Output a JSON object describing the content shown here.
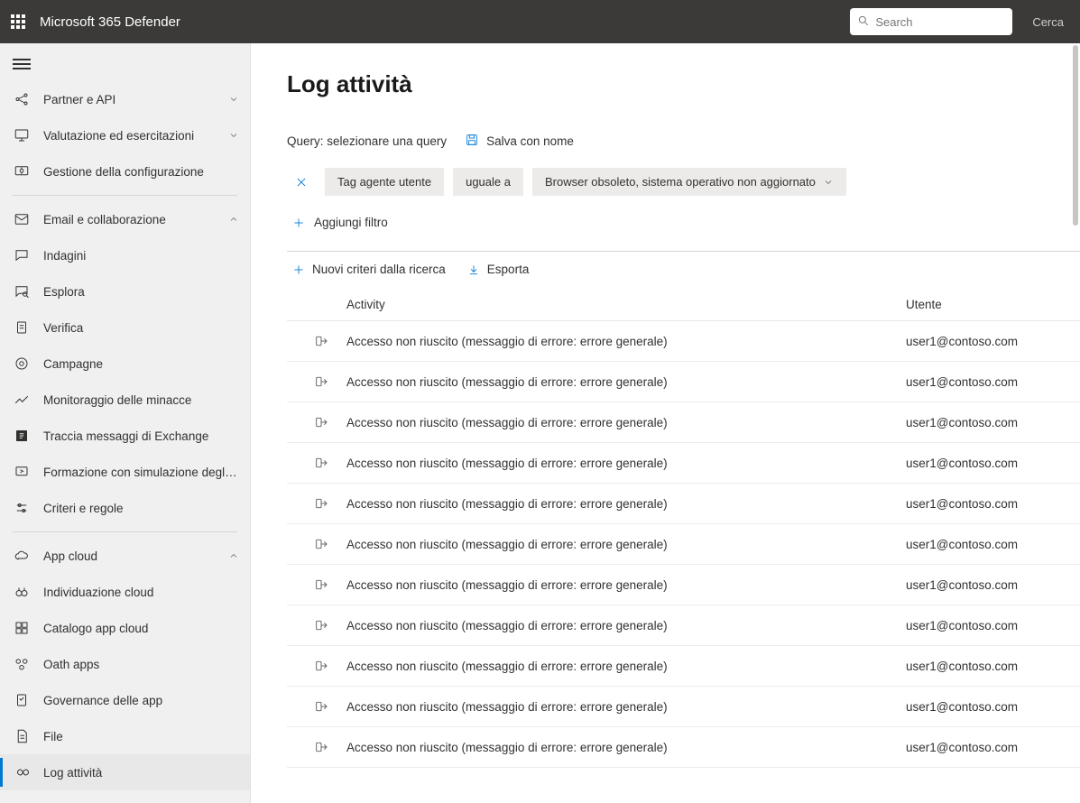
{
  "header": {
    "app_title": "Microsoft 365 Defender",
    "search_placeholder": "Search",
    "search_side_text": "Cerca"
  },
  "sidebar": {
    "groups": [
      {
        "items": [
          {
            "icon": "share-nodes",
            "label": "Partner e API",
            "chevron": "down"
          },
          {
            "icon": "monitor",
            "label": "Valutazione ed esercitazioni",
            "chevron": "down"
          },
          {
            "icon": "gear-monitor",
            "label": "Gestione della configurazione"
          }
        ]
      },
      {
        "items": [
          {
            "icon": "mail",
            "label": "Email e collaborazione",
            "chevron": "up"
          },
          {
            "icon": "chat",
            "label": "Indagini"
          },
          {
            "icon": "explore",
            "label": "Esplora"
          },
          {
            "icon": "clipboard",
            "label": "Verifica"
          },
          {
            "icon": "target",
            "label": "Campagne"
          },
          {
            "icon": "chart",
            "label": "Monitoraggio delle minacce"
          },
          {
            "icon": "exchange",
            "label": "Traccia messaggi di Exchange"
          },
          {
            "icon": "training",
            "label": "Formazione con simulazione degli attacchi"
          },
          {
            "icon": "sliders",
            "label": "Criteri e regole"
          }
        ]
      },
      {
        "items": [
          {
            "icon": "cloud",
            "label": "App cloud",
            "chevron": "up"
          },
          {
            "icon": "binoculars",
            "label": "Individuazione cloud"
          },
          {
            "icon": "grid",
            "label": "Catalogo app cloud"
          },
          {
            "icon": "oauth",
            "label": "Oath apps"
          },
          {
            "icon": "governance",
            "label": "Governance delle app"
          },
          {
            "icon": "file",
            "label": "File"
          },
          {
            "icon": "infinity",
            "label": "Log attività",
            "active": true
          }
        ]
      }
    ]
  },
  "main": {
    "title": "Log attività",
    "query_label": "Query: selezionare una query",
    "save_as": "Salva con nome",
    "filter": {
      "field": "Tag agente utente",
      "operator": "uguale a",
      "value": "Browser obsoleto, sistema operativo non aggiornato"
    },
    "add_filter": "Aggiungi filtro",
    "actions": {
      "new_policy": "Nuovi criteri dalla ricerca",
      "export": "Esporta"
    },
    "columns": {
      "activity": "Activity",
      "user": "Utente"
    },
    "rows": [
      {
        "activity": "Accesso non riuscito (messaggio di errore: errore generale)",
        "user": "user1@contoso.com"
      },
      {
        "activity": "Accesso non riuscito (messaggio di errore: errore generale)",
        "user": "user1@contoso.com"
      },
      {
        "activity": "Accesso non riuscito (messaggio di errore: errore generale)",
        "user": "user1@contoso.com"
      },
      {
        "activity": "Accesso non riuscito (messaggio di errore: errore generale)",
        "user": "user1@contoso.com"
      },
      {
        "activity": "Accesso non riuscito (messaggio di errore: errore generale)",
        "user": "user1@contoso.com"
      },
      {
        "activity": "Accesso non riuscito (messaggio di errore: errore generale)",
        "user": "user1@contoso.com"
      },
      {
        "activity": "Accesso non riuscito (messaggio di errore: errore generale)",
        "user": "user1@contoso.com"
      },
      {
        "activity": "Accesso non riuscito (messaggio di errore: errore generale)",
        "user": "user1@contoso.com"
      },
      {
        "activity": "Accesso non riuscito (messaggio di errore: errore generale)",
        "user": "user1@contoso.com"
      },
      {
        "activity": "Accesso non riuscito (messaggio di errore: errore generale)",
        "user": "user1@contoso.com"
      },
      {
        "activity": "Accesso non riuscito (messaggio di errore: errore generale)",
        "user": "user1@contoso.com"
      }
    ]
  }
}
